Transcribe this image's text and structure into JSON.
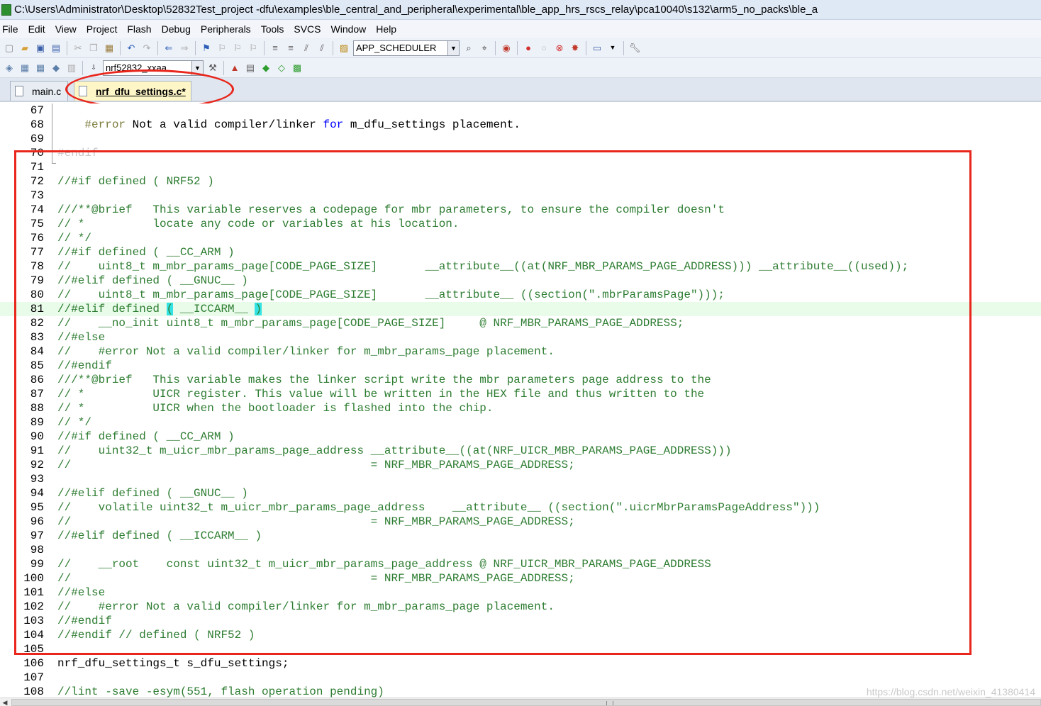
{
  "window": {
    "title": "C:\\Users\\Administrator\\Desktop\\52832Test_project -dfu\\examples\\ble_central_and_peripheral\\experimental\\ble_app_hrs_rscs_relay\\pca10040\\s132\\arm5_no_packs\\ble_a"
  },
  "menu": [
    "File",
    "Edit",
    "View",
    "Project",
    "Flash",
    "Debug",
    "Peripherals",
    "Tools",
    "SVCS",
    "Window",
    "Help"
  ],
  "toolbar": {
    "function_combo": "APP_SCHEDULER",
    "target_combo": "nrf52832_xxaa"
  },
  "tabs": [
    {
      "label": "main.c",
      "active": false
    },
    {
      "label": "nrf_dfu_settings.c*",
      "active": true
    }
  ],
  "colors": {
    "annotation": "#e8261c",
    "current_line": "#e9fbe9",
    "comment": "#2e7d32",
    "keyword": "#0000ff"
  },
  "code": [
    {
      "n": "67",
      "t": ""
    },
    {
      "n": "68",
      "t": "    #error Not a valid compiler/linker for m_dfu_settings placement."
    },
    {
      "n": "69",
      "t": ""
    },
    {
      "n": "70",
      "t": "#endif"
    },
    {
      "n": "71",
      "t": ""
    },
    {
      "n": "72",
      "t": "//#if defined ( NRF52 )"
    },
    {
      "n": "73",
      "t": ""
    },
    {
      "n": "74",
      "t": "///**@brief   This variable reserves a codepage for mbr parameters, to ensure the compiler doesn't"
    },
    {
      "n": "75",
      "t": "// *          locate any code or variables at his location."
    },
    {
      "n": "76",
      "t": "// */"
    },
    {
      "n": "77",
      "t": "//#if defined ( __CC_ARM )"
    },
    {
      "n": "78",
      "t": "//    uint8_t m_mbr_params_page[CODE_PAGE_SIZE]       __attribute__((at(NRF_MBR_PARAMS_PAGE_ADDRESS))) __attribute__((used));"
    },
    {
      "n": "79",
      "t": "//#elif defined ( __GNUC__ )"
    },
    {
      "n": "80",
      "t": "//    uint8_t m_mbr_params_page[CODE_PAGE_SIZE]       __attribute__ ((section(\".mbrParamsPage\")));"
    },
    {
      "n": "81",
      "t": "//#elif defined ( __ICCARM__ )"
    },
    {
      "n": "82",
      "t": "//    __no_init uint8_t m_mbr_params_page[CODE_PAGE_SIZE]     @ NRF_MBR_PARAMS_PAGE_ADDRESS;"
    },
    {
      "n": "83",
      "t": "//#else"
    },
    {
      "n": "84",
      "t": "//    #error Not a valid compiler/linker for m_mbr_params_page placement."
    },
    {
      "n": "85",
      "t": "//#endif"
    },
    {
      "n": "86",
      "t": "///**@brief   This variable makes the linker script write the mbr parameters page address to the"
    },
    {
      "n": "87",
      "t": "// *          UICR register. This value will be written in the HEX file and thus written to the"
    },
    {
      "n": "88",
      "t": "// *          UICR when the bootloader is flashed into the chip."
    },
    {
      "n": "89",
      "t": "// */"
    },
    {
      "n": "90",
      "t": "//#if defined ( __CC_ARM )"
    },
    {
      "n": "91",
      "t": "//    uint32_t m_uicr_mbr_params_page_address __attribute__((at(NRF_UICR_MBR_PARAMS_PAGE_ADDRESS)))"
    },
    {
      "n": "92",
      "t": "//                                            = NRF_MBR_PARAMS_PAGE_ADDRESS;"
    },
    {
      "n": "93",
      "t": ""
    },
    {
      "n": "94",
      "t": "//#elif defined ( __GNUC__ )"
    },
    {
      "n": "95",
      "t": "//    volatile uint32_t m_uicr_mbr_params_page_address    __attribute__ ((section(\".uicrMbrParamsPageAddress\")))"
    },
    {
      "n": "96",
      "t": "//                                            = NRF_MBR_PARAMS_PAGE_ADDRESS;"
    },
    {
      "n": "97",
      "t": "//#elif defined ( __ICCARM__ )"
    },
    {
      "n": "98",
      "t": ""
    },
    {
      "n": "99",
      "t": "//    __root    const uint32_t m_uicr_mbr_params_page_address @ NRF_UICR_MBR_PARAMS_PAGE_ADDRESS"
    },
    {
      "n": "100",
      "t": "//                                            = NRF_MBR_PARAMS_PAGE_ADDRESS;"
    },
    {
      "n": "101",
      "t": "//#else"
    },
    {
      "n": "102",
      "t": "//    #error Not a valid compiler/linker for m_mbr_params_page placement."
    },
    {
      "n": "103",
      "t": "//#endif"
    },
    {
      "n": "104",
      "t": "//#endif // defined ( NRF52 )"
    },
    {
      "n": "105",
      "t": ""
    },
    {
      "n": "106",
      "t": "nrf_dfu_settings_t s_dfu_settings;"
    },
    {
      "n": "107",
      "t": ""
    },
    {
      "n": "108",
      "t": "//lint -save -esym(551, flash operation pending)"
    }
  ],
  "current_line": "81",
  "watermark": "https://blog.csdn.net/weixin_41380414"
}
